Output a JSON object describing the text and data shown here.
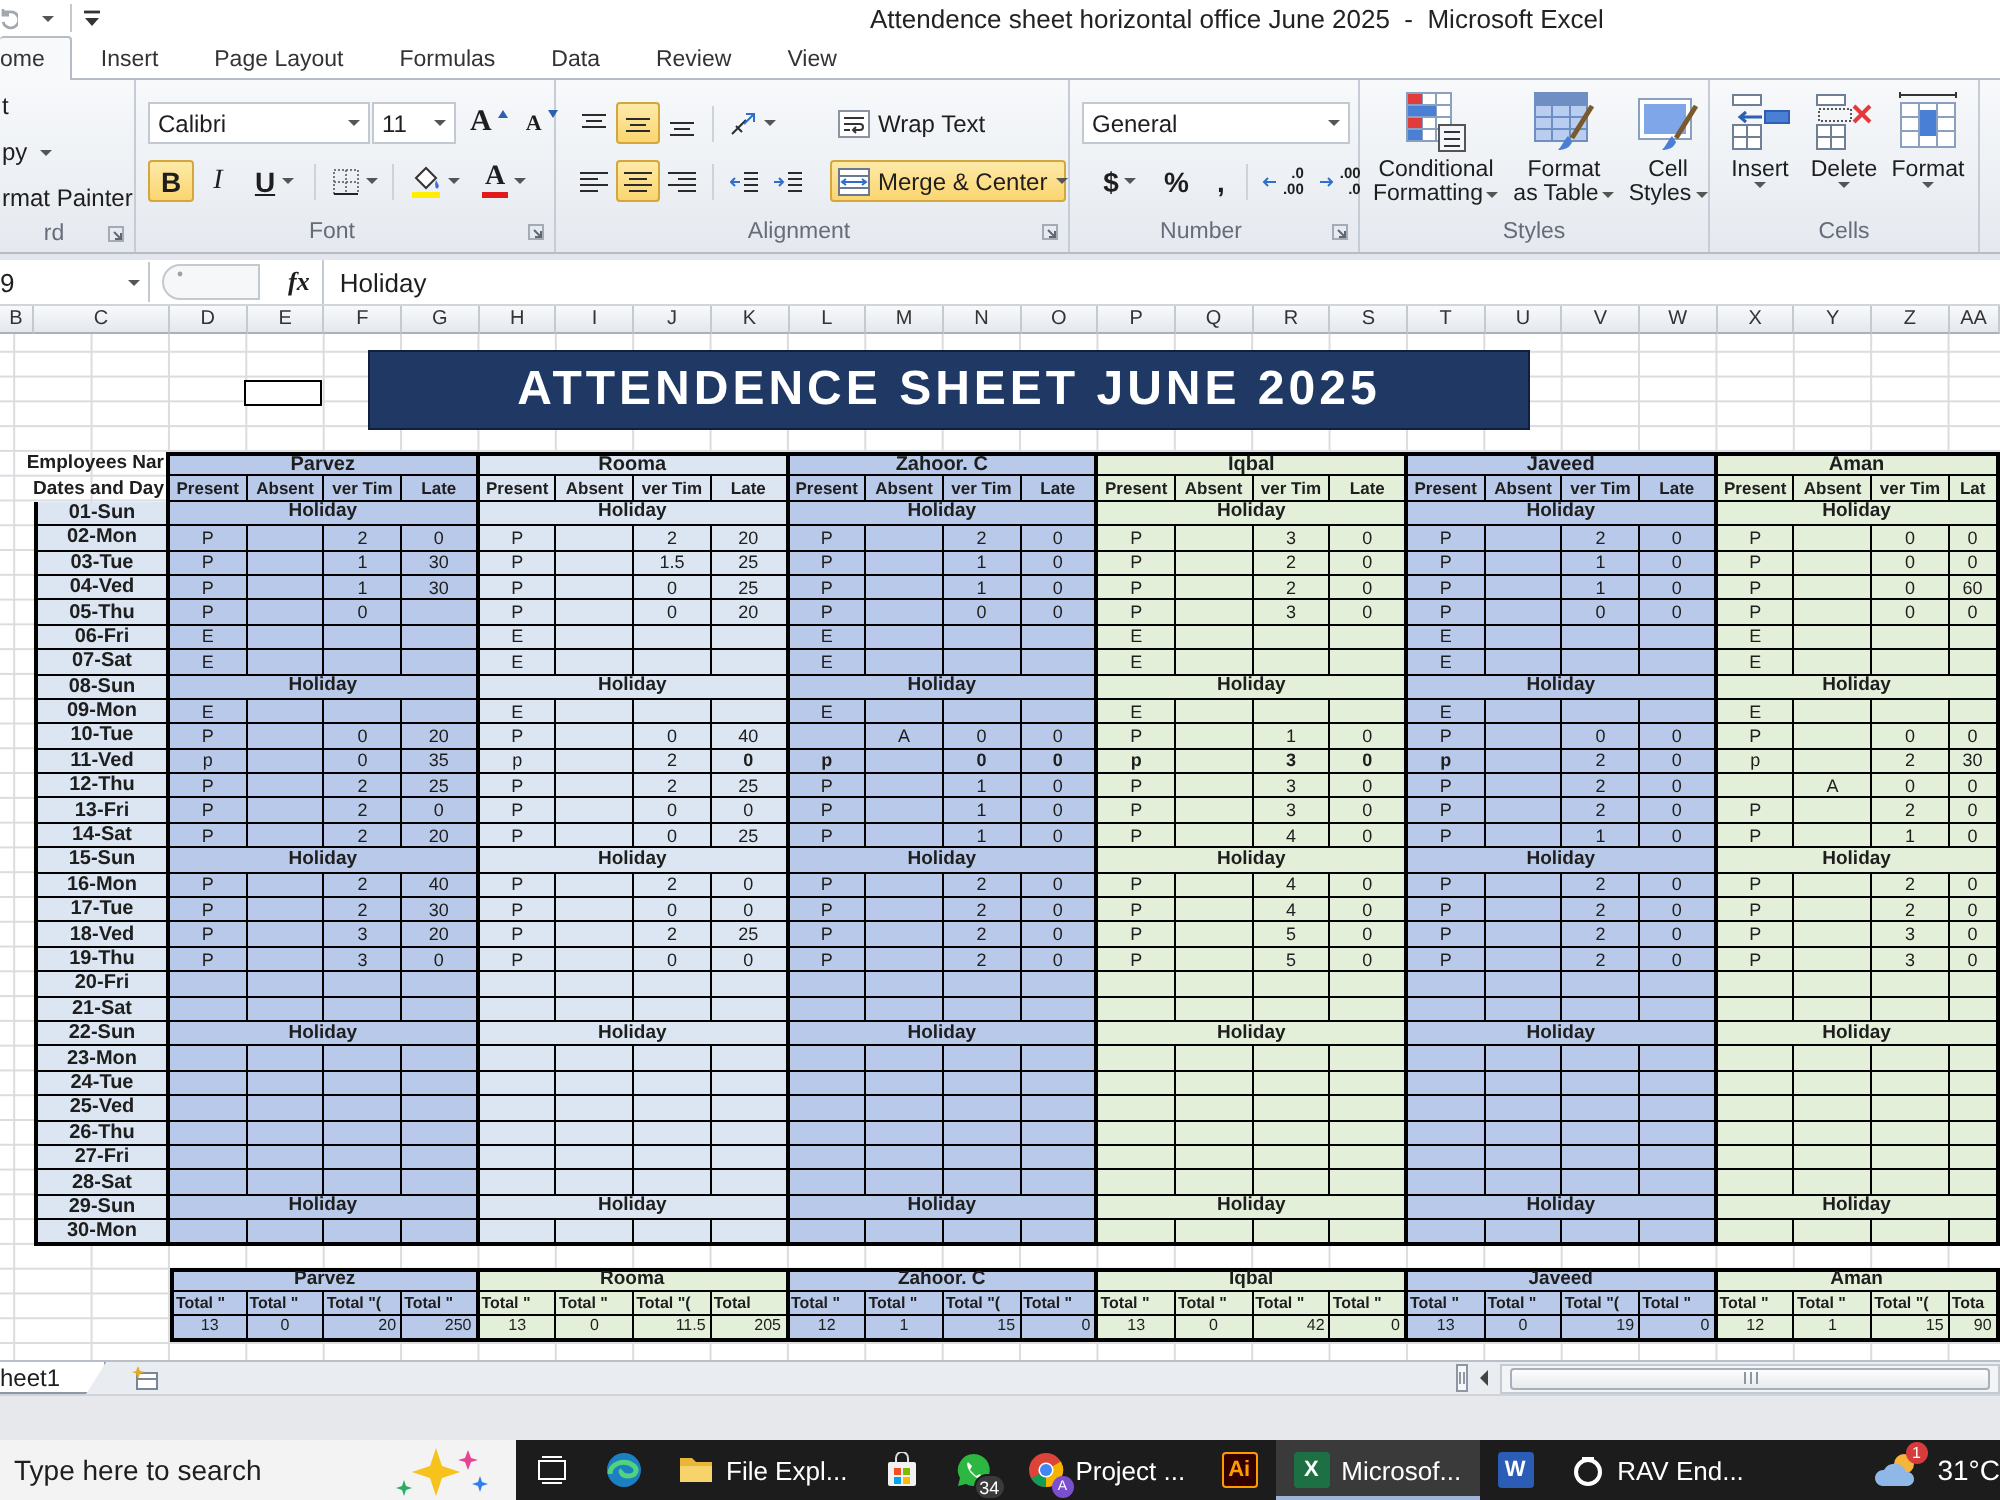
{
  "window": {
    "title": "Attendence sheet horizontal office June 2025  -  Microsoft Excel"
  },
  "ribbon_tabs": [
    {
      "label": "ome",
      "selected": true
    },
    {
      "label": "Insert",
      "selected": false
    },
    {
      "label": "Page Layout",
      "selected": false
    },
    {
      "label": "Formulas",
      "selected": false
    },
    {
      "label": "Data",
      "selected": false
    },
    {
      "label": "Review",
      "selected": false
    },
    {
      "label": "View",
      "selected": false
    }
  ],
  "clipboard": {
    "label": "rd",
    "items": [
      {
        "label": "t",
        "menu": false
      },
      {
        "label": "py",
        "menu": true
      },
      {
        "label": "rmat Painter",
        "menu": false
      }
    ]
  },
  "font_group": {
    "label": "Font",
    "family": "Calibri",
    "size": "11",
    "size_tools": [
      {
        "kind": "grow",
        "glyph": "A"
      },
      {
        "kind": "shrink",
        "glyph": "A"
      }
    ],
    "tools": [
      {
        "kind": "bold",
        "glyph": "B",
        "on": true
      },
      {
        "kind": "italic",
        "glyph": "I",
        "on": false
      },
      {
        "kind": "underline",
        "glyph": "U",
        "on": false
      },
      {
        "kind": "borders",
        "on": false
      },
      {
        "kind": "fill",
        "on": false
      },
      {
        "kind": "font_color",
        "glyph": "A",
        "on": false
      }
    ]
  },
  "alignment": {
    "label": "Alignment",
    "top_tools": [
      {
        "kind": "top",
        "on": false
      },
      {
        "kind": "middle",
        "on": true
      },
      {
        "kind": "bottom",
        "on": false
      },
      {
        "kind": "orientation",
        "on": false
      }
    ],
    "bottom_tools": [
      {
        "kind": "left",
        "on": false
      },
      {
        "kind": "center",
        "on": true
      },
      {
        "kind": "right",
        "on": false
      },
      {
        "kind": "outdent",
        "on": false
      },
      {
        "kind": "indent",
        "on": false
      }
    ],
    "wrap": {
      "label": "Wrap Text",
      "on": false
    },
    "merge": {
      "label": "Merge & Center",
      "on": true
    }
  },
  "number": {
    "label": "Number",
    "format": "General",
    "tools": [
      {
        "kind": "currency",
        "glyph": "$"
      },
      {
        "kind": "percent",
        "glyph": "%"
      },
      {
        "kind": "comma",
        "glyph": ","
      },
      {
        "kind": "more_decimals",
        "lines": [
          ".0",
          ".00"
        ]
      },
      {
        "kind": "fewer_decimals",
        "lines": [
          ".00",
          ".0"
        ]
      }
    ]
  },
  "styles": {
    "label": "Styles",
    "buttons": [
      {
        "kind": "conditional",
        "lines": [
          "Conditional",
          "Formatting"
        ]
      },
      {
        "kind": "table",
        "lines": [
          "Format",
          "as Table"
        ]
      },
      {
        "kind": "cell_styles",
        "lines": [
          "Cell",
          "Styles"
        ]
      }
    ]
  },
  "cells": {
    "label": "Cells",
    "buttons": [
      {
        "kind": "insert",
        "label": "Insert"
      },
      {
        "kind": "delete",
        "label": "Delete"
      },
      {
        "kind": "format",
        "label": "Format"
      }
    ]
  },
  "formula_bar": {
    "name_box": "9",
    "function_label": "fx",
    "value": "Holiday"
  },
  "columns": [
    "B",
    "C",
    "D",
    "E",
    "F",
    "G",
    "H",
    "I",
    "J",
    "K",
    "L",
    "M",
    "N",
    "O",
    "P",
    "Q",
    "R",
    "S",
    "T",
    "U",
    "V",
    "W",
    "X",
    "Y",
    "Z",
    "AA"
  ],
  "banner": {
    "title": "ATTENDENCE SHEET JUNE 2025"
  },
  "attendance": {
    "name_label": "Employees Nar",
    "date_label": "Dates and Day",
    "employees": [
      {
        "name": "Parvez",
        "color": "#b8c9e9",
        "columns": [
          "Present",
          "Absent",
          "ver Tim",
          "Late"
        ]
      },
      {
        "name": "Rooma",
        "color": "#dce6f2",
        "columns": [
          "Present",
          "Absent",
          "ver Tim",
          "Late"
        ]
      },
      {
        "name": "Zahoor. C",
        "color": "#b8c9e9",
        "columns": [
          "Present",
          "Absent",
          "ver Tim",
          "Late"
        ]
      },
      {
        "name": "Iqbal",
        "color": "#e4efd9",
        "columns": [
          "Present",
          "Absent",
          "ver Tim",
          "Late"
        ]
      },
      {
        "name": "Javeed",
        "color": "#b8c9e9",
        "columns": [
          "Present",
          "Absent",
          "ver Tim",
          "Late"
        ]
      },
      {
        "name": "Aman",
        "color": "#e4efd9",
        "columns": [
          "Present",
          "Absent",
          "ver Tim",
          "Lat"
        ]
      }
    ],
    "rows": [
      {
        "date": "01-Sun",
        "kind": "holiday",
        "cells": [
          "Holiday",
          "Holiday",
          "Holiday",
          "Holiday",
          "Holiday",
          "Holiday"
        ]
      },
      {
        "date": "02-Mon",
        "kind": "day",
        "cells": [
          {
            "present": "P",
            "overtime": "2",
            "late": "0"
          },
          {
            "present": "P",
            "overtime": "2",
            "late": "20"
          },
          {
            "present": "P",
            "overtime": "2",
            "late": "0"
          },
          {
            "present": "P",
            "overtime": "3",
            "late": "0"
          },
          {
            "present": "P",
            "overtime": "2",
            "late": "0"
          },
          {
            "present": "P",
            "overtime": "0",
            "late": "0"
          }
        ]
      },
      {
        "date": "03-Tue",
        "kind": "day",
        "cells": [
          {
            "present": "P",
            "overtime": "1",
            "late": "30"
          },
          {
            "present": "P",
            "overtime": "1.5",
            "late": "25"
          },
          {
            "present": "P",
            "overtime": "1",
            "late": "0"
          },
          {
            "present": "P",
            "overtime": "2",
            "late": "0"
          },
          {
            "present": "P",
            "overtime": "1",
            "late": "0"
          },
          {
            "present": "P",
            "overtime": "0",
            "late": "0"
          }
        ]
      },
      {
        "date": "04-Ved",
        "kind": "day",
        "cells": [
          {
            "present": "P",
            "overtime": "1",
            "late": "30"
          },
          {
            "present": "P",
            "overtime": "0",
            "late": "25"
          },
          {
            "present": "P",
            "overtime": "1",
            "late": "0"
          },
          {
            "present": "P",
            "overtime": "2",
            "late": "0"
          },
          {
            "present": "P",
            "overtime": "1",
            "late": "0"
          },
          {
            "present": "P",
            "overtime": "0",
            "late": "60"
          }
        ]
      },
      {
        "date": "05-Thu",
        "kind": "day",
        "cells": [
          {
            "present": "P",
            "overtime": "0"
          },
          {
            "present": "P",
            "overtime": "0",
            "late": "20"
          },
          {
            "present": "P",
            "overtime": "0",
            "late": "0"
          },
          {
            "present": "P",
            "overtime": "3",
            "late": "0"
          },
          {
            "present": "P",
            "overtime": "0",
            "late": "0"
          },
          {
            "present": "P",
            "overtime": "0",
            "late": "0"
          }
        ]
      },
      {
        "date": "06-Fri",
        "kind": "day",
        "cells": [
          {
            "present": "E"
          },
          {
            "present": "E"
          },
          {
            "present": "E"
          },
          {
            "present": "E"
          },
          {
            "present": "E"
          },
          {
            "present": "E"
          }
        ]
      },
      {
        "date": "07-Sat",
        "kind": "day",
        "cells": [
          {
            "present": "E"
          },
          {
            "present": "E"
          },
          {
            "present": "E"
          },
          {
            "present": "E"
          },
          {
            "present": "E"
          },
          {
            "present": "E"
          }
        ]
      },
      {
        "date": "08-Sun",
        "kind": "holiday",
        "cells": [
          "Holiday",
          "Holiday",
          "Holiday",
          "Holiday",
          "Holiday",
          "Holiday"
        ]
      },
      {
        "date": "09-Mon",
        "kind": "day",
        "cells": [
          {
            "present": "E"
          },
          {
            "present": "E"
          },
          {
            "present": "E"
          },
          {
            "present": "E"
          },
          {
            "present": "E"
          },
          {
            "present": "E"
          }
        ]
      },
      {
        "date": "10-Tue",
        "kind": "day",
        "cells": [
          {
            "present": "P",
            "overtime": "0",
            "late": "20"
          },
          {
            "present": "P",
            "overtime": "0",
            "late": "40"
          },
          {
            "absent": "A",
            "overtime": "0",
            "late": "0"
          },
          {
            "present": "P",
            "overtime": "1",
            "late": "0"
          },
          {
            "present": "P",
            "overtime": "0",
            "late": "0"
          },
          {
            "present": "P",
            "overtime": "0",
            "late": "0"
          }
        ]
      },
      {
        "date": "11-Ved",
        "kind": "day",
        "cells": [
          {
            "present": "p",
            "overtime": "0",
            "late": "35",
            "present_bold": false,
            "overtime_bold": false,
            "late_bold": false
          },
          {
            "present": "p",
            "overtime": "2",
            "late": "0",
            "present_bold": false,
            "overtime_bold": false,
            "late_bold": true
          },
          {
            "present": "p",
            "overtime": "0",
            "late": "0",
            "present_bold": true,
            "overtime_bold": true,
            "late_bold": true
          },
          {
            "present": "p",
            "overtime": "3",
            "late": "0",
            "present_bold": true,
            "overtime_bold": true,
            "late_bold": true
          },
          {
            "present": "p",
            "overtime": "2",
            "late": "0",
            "present_bold": true,
            "overtime_bold": false,
            "late_bold": false
          },
          {
            "present": "p",
            "overtime": "2",
            "late": "30",
            "present_bold": false,
            "overtime_bold": false,
            "late_bold": false
          }
        ]
      },
      {
        "date": "12-Thu",
        "kind": "day",
        "cells": [
          {
            "present": "P",
            "overtime": "2",
            "late": "25"
          },
          {
            "present": "P",
            "overtime": "2",
            "late": "25"
          },
          {
            "present": "P",
            "overtime": "1",
            "late": "0"
          },
          {
            "present": "P",
            "overtime": "3",
            "late": "0"
          },
          {
            "present": "P",
            "overtime": "2",
            "late": "0"
          },
          {
            "absent": "A",
            "overtime": "0",
            "late": "0"
          }
        ]
      },
      {
        "date": "13-Fri",
        "kind": "day",
        "cells": [
          {
            "present": "P",
            "overtime": "2",
            "late": "0"
          },
          {
            "present": "P",
            "overtime": "0",
            "late": "0"
          },
          {
            "present": "P",
            "overtime": "1",
            "late": "0"
          },
          {
            "present": "P",
            "overtime": "3",
            "late": "0"
          },
          {
            "present": "P",
            "overtime": "2",
            "late": "0"
          },
          {
            "present": "P",
            "overtime": "2",
            "late": "0"
          }
        ]
      },
      {
        "date": "14-Sat",
        "kind": "day",
        "cells": [
          {
            "present": "P",
            "overtime": "2",
            "late": "20"
          },
          {
            "present": "P",
            "overtime": "0",
            "late": "25"
          },
          {
            "present": "P",
            "overtime": "1",
            "late": "0"
          },
          {
            "present": "P",
            "overtime": "4",
            "late": "0"
          },
          {
            "present": "P",
            "overtime": "1",
            "late": "0"
          },
          {
            "present": "P",
            "overtime": "1",
            "late": "0"
          }
        ]
      },
      {
        "date": "15-Sun",
        "kind": "holiday",
        "cells": [
          "Holiday",
          "Holiday",
          "Holiday",
          "Holiday",
          "Holiday",
          "Holiday"
        ]
      },
      {
        "date": "16-Mon",
        "kind": "day",
        "cells": [
          {
            "present": "P",
            "overtime": "2",
            "late": "40"
          },
          {
            "present": "P",
            "overtime": "2",
            "late": "0"
          },
          {
            "present": "P",
            "overtime": "2",
            "late": "0"
          },
          {
            "present": "P",
            "overtime": "4",
            "late": "0"
          },
          {
            "present": "P",
            "overtime": "2",
            "late": "0"
          },
          {
            "present": "P",
            "overtime": "2",
            "late": "0"
          }
        ]
      },
      {
        "date": "17-Tue",
        "kind": "day",
        "cells": [
          {
            "present": "P",
            "overtime": "2",
            "late": "30"
          },
          {
            "present": "P",
            "overtime": "0",
            "late": "0"
          },
          {
            "present": "P",
            "overtime": "2",
            "late": "0"
          },
          {
            "present": "P",
            "overtime": "4",
            "late": "0"
          },
          {
            "present": "P",
            "overtime": "2",
            "late": "0"
          },
          {
            "present": "P",
            "overtime": "2",
            "late": "0"
          }
        ]
      },
      {
        "date": "18-Ved",
        "kind": "day",
        "cells": [
          {
            "present": "P",
            "overtime": "3",
            "late": "20"
          },
          {
            "present": "P",
            "overtime": "2",
            "late": "25"
          },
          {
            "present": "P",
            "overtime": "2",
            "late": "0"
          },
          {
            "present": "P",
            "overtime": "5",
            "late": "0"
          },
          {
            "present": "P",
            "overtime": "2",
            "late": "0"
          },
          {
            "present": "P",
            "overtime": "3",
            "late": "0"
          }
        ]
      },
      {
        "date": "19-Thu",
        "kind": "day",
        "cells": [
          {
            "present": "P",
            "overtime": "3",
            "late": "0"
          },
          {
            "present": "P",
            "overtime": "0",
            "late": "0"
          },
          {
            "present": "P",
            "overtime": "2",
            "late": "0"
          },
          {
            "present": "P",
            "overtime": "5",
            "late": "0"
          },
          {
            "present": "P",
            "overtime": "2",
            "late": "0"
          },
          {
            "present": "P",
            "overtime": "3",
            "late": "0"
          }
        ]
      },
      {
        "date": "20-Fri",
        "kind": "day"
      },
      {
        "date": "21-Sat",
        "kind": "day"
      },
      {
        "date": "22-Sun",
        "kind": "holiday",
        "cells": [
          "Holiday",
          "Holiday",
          "Holiday",
          "Holiday",
          "Holiday",
          "Holiday"
        ]
      },
      {
        "date": "23-Mon",
        "kind": "day"
      },
      {
        "date": "24-Tue",
        "kind": "day"
      },
      {
        "date": "25-Ved",
        "kind": "day"
      },
      {
        "date": "26-Thu",
        "kind": "day"
      },
      {
        "date": "27-Fri",
        "kind": "day"
      },
      {
        "date": "28-Sat",
        "kind": "day"
      },
      {
        "date": "29-Sun",
        "kind": "holiday",
        "cells": [
          "Holiday",
          "Holiday",
          "Holiday",
          "Holiday",
          "Holiday",
          "Holiday"
        ]
      },
      {
        "date": "30-Mon",
        "kind": "day"
      }
    ]
  },
  "totals": {
    "employees": [
      {
        "name": "Parvez",
        "color": "#b8c9e9",
        "headers": [
          "Total \"",
          "Total \"",
          "Total \"(",
          "Total \""
        ],
        "values": [
          "13",
          "0",
          "20",
          "250"
        ]
      },
      {
        "name": "Rooma",
        "color": "#e4efd9",
        "headers": [
          "Total \"",
          "Total \"",
          "Total \"(",
          "Total"
        ],
        "values": [
          "13",
          "0",
          "11.5",
          "205"
        ]
      },
      {
        "name": "Zahoor. C",
        "color": "#b8c9e9",
        "headers": [
          "Total \"",
          "Total \"",
          "Total \"(",
          "Total \""
        ],
        "values": [
          "12",
          "1",
          "15",
          "0"
        ]
      },
      {
        "name": "Iqbal",
        "color": "#e4efd9",
        "headers": [
          "Total \"",
          "Total \"",
          "Total \"",
          "Total \""
        ],
        "values": [
          "13",
          "0",
          "42",
          "0"
        ]
      },
      {
        "name": "Javeed",
        "color": "#b8c9e9",
        "headers": [
          "Total \"",
          "Total \"",
          "Total \"(",
          "Total \""
        ],
        "values": [
          "13",
          "0",
          "19",
          "0"
        ]
      },
      {
        "name": "Aman",
        "color": "#e4efd9",
        "headers": [
          "Total \"",
          "Total \"",
          "Total \"(",
          "Tota"
        ],
        "values": [
          "12",
          "1",
          "15",
          "90"
        ]
      }
    ]
  },
  "sheet_tabs": [
    {
      "label": "heet1",
      "selected": true
    }
  ],
  "taskbar": {
    "search": {
      "placeholder": "Type here to search"
    },
    "apps": [
      {
        "kind": "task_view",
        "selected": false
      },
      {
        "kind": "edge",
        "selected": false
      },
      {
        "kind": "explorer",
        "label": "File Expl...",
        "selected": false
      },
      {
        "kind": "store",
        "selected": false
      },
      {
        "kind": "whatsapp",
        "badge": "34",
        "selected": false
      },
      {
        "kind": "chrome",
        "label": "Project ...",
        "avatar": "A",
        "selected": false
      },
      {
        "kind": "illustrator",
        "glyph": "Ai",
        "selected": false
      },
      {
        "kind": "excel",
        "glyph": "X",
        "label": "Microsof...",
        "selected": true
      },
      {
        "kind": "word",
        "glyph": "W",
        "selected": false
      },
      {
        "kind": "rav",
        "label": "RAV End...",
        "selected": false
      }
    ],
    "weather": {
      "badge": "1",
      "temperature": "31°C"
    }
  }
}
